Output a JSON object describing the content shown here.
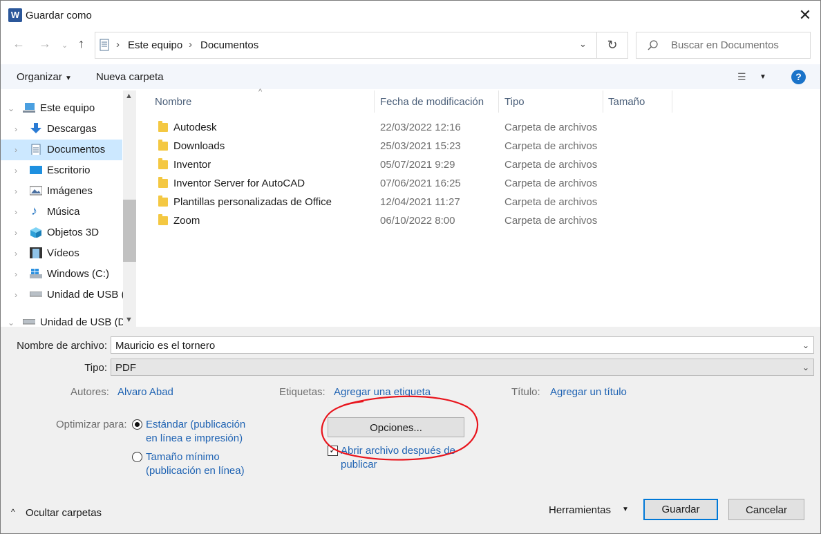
{
  "window": {
    "title": "Guardar como",
    "app_icon_letter": "W",
    "brand_color": "#2b579a"
  },
  "address": {
    "items": [
      "Este equipo",
      "Documentos"
    ]
  },
  "search": {
    "placeholder": "Buscar en Documentos"
  },
  "toolbar": {
    "organize": "Organizar",
    "new_folder": "Nueva carpeta"
  },
  "tree": {
    "items": [
      {
        "label": "Este equipo",
        "icon": "computer-icon"
      },
      {
        "label": "Descargas",
        "icon": "download-icon"
      },
      {
        "label": "Documentos",
        "icon": "documents-icon",
        "selected": true
      },
      {
        "label": "Escritorio",
        "icon": "desktop-icon"
      },
      {
        "label": "Imágenes",
        "icon": "pictures-icon"
      },
      {
        "label": "Música",
        "icon": "music-icon"
      },
      {
        "label": "Objetos 3D",
        "icon": "3d-objects-icon"
      },
      {
        "label": "Vídeos",
        "icon": "videos-icon"
      },
      {
        "label": "Windows  (C:)",
        "icon": "drive-icon"
      },
      {
        "label": "Unidad de USB (",
        "icon": "usb-drive-icon"
      },
      {
        "label": "Unidad de USB (D",
        "icon": "usb-drive-icon"
      }
    ]
  },
  "columns": {
    "name": "Nombre",
    "date": "Fecha de modificación",
    "type": "Tipo",
    "size": "Tamaño"
  },
  "files": [
    {
      "name": "Autodesk",
      "date": "22/03/2022 12:16",
      "type": "Carpeta de archivos"
    },
    {
      "name": "Downloads",
      "date": "25/03/2021 15:23",
      "type": "Carpeta de archivos"
    },
    {
      "name": "Inventor",
      "date": "05/07/2021 9:29",
      "type": "Carpeta de archivos"
    },
    {
      "name": "Inventor Server for AutoCAD",
      "date": "07/06/2021 16:25",
      "type": "Carpeta de archivos"
    },
    {
      "name": "Plantillas personalizadas de Office",
      "date": "12/04/2021 11:27",
      "type": "Carpeta de archivos"
    },
    {
      "name": "Zoom",
      "date": "06/10/2022 8:00",
      "type": "Carpeta de archivos"
    }
  ],
  "form": {
    "filename_label": "Nombre de archivo:",
    "filename_value": "Mauricio es el tornero",
    "type_label": "Tipo:",
    "type_value": "PDF",
    "authors_label": "Autores:",
    "authors_value": "Alvaro Abad",
    "tags_label": "Etiquetas:",
    "tags_value": "Agregar una etiqueta",
    "title_label": "Título:",
    "title_value": "Agregar un título",
    "optimize_label": "Optimizar para:",
    "opt_standard_l1": "Estándar (publicación",
    "opt_standard_l2": "en línea e impresión)",
    "opt_min_l1": "Tamaño mínimo",
    "opt_min_l2": "(publicación en línea)",
    "options_button": "Opciones...",
    "open_after_l1": "Abrir archivo después de",
    "open_after_l2": "publicar"
  },
  "footer": {
    "hide_folders": "Ocultar carpetas",
    "tools": "Herramientas",
    "save": "Guardar",
    "cancel": "Cancelar"
  },
  "annotation": {
    "color": "#e8141c"
  }
}
